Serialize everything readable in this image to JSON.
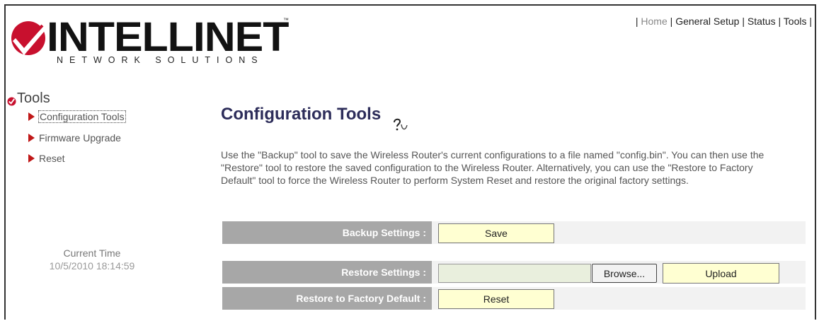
{
  "brand": {
    "name": "INTELLINET",
    "tagline": "NETWORK SOLUTIONS",
    "trademark": "™"
  },
  "topnav": {
    "items": [
      "Home",
      "General Setup",
      "Status",
      "Tools"
    ]
  },
  "sidebar": {
    "title": "Tools",
    "items": [
      {
        "label": "Configuration Tools"
      },
      {
        "label": "Firmware Upgrade"
      },
      {
        "label": "Reset"
      }
    ],
    "time_label": "Current Time",
    "time_value": "10/5/2010 18:14:59"
  },
  "main": {
    "title": "Configuration Tools",
    "description": "Use the \"Backup\" tool to save the Wireless Router's current configurations to a file named \"config.bin\". You can then use the \"Restore\" tool to restore the saved configuration to the Wireless Router. Alternatively, you can use the \"Restore to Factory Default\" tool to force the Wireless Router to perform System Reset and restore the original factory settings.",
    "backup": {
      "label": "Backup Settings :",
      "button": "Save"
    },
    "restore": {
      "label": "Restore Settings :",
      "browse": "Browse...",
      "upload": "Upload"
    },
    "factory": {
      "label": "Restore to Factory Default :",
      "button": "Reset"
    }
  },
  "colors": {
    "label_bg": "#a7a7a7",
    "button_bg": "#ffffd2",
    "title": "#2d2d5a",
    "accent_red": "#c01818"
  }
}
